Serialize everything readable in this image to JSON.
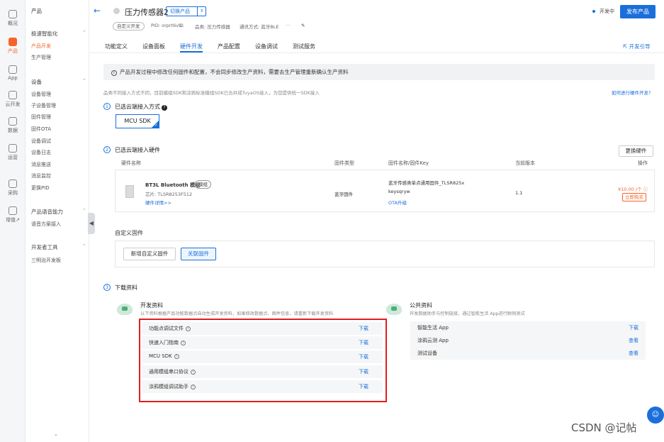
{
  "rail": [
    {
      "label": "概况",
      "icon": "home-icon",
      "active": false
    },
    {
      "label": "产品",
      "icon": "product-icon",
      "active": true
    },
    {
      "label": "App",
      "icon": "app-icon",
      "active": false
    },
    {
      "label": "云开发",
      "icon": "cloud-icon",
      "active": false
    },
    {
      "label": "数据",
      "icon": "chart-icon",
      "active": false
    },
    {
      "label": "运营",
      "icon": "operate-icon",
      "active": false
    },
    {
      "label": "采购",
      "icon": "cart-icon",
      "active": false
    },
    {
      "label": "增值↗",
      "icon": "diamond-icon",
      "active": false
    }
  ],
  "sidebar": {
    "title": "产品",
    "g1": "极速智能化",
    "g1_items": [
      "产品开发",
      "生产管理"
    ],
    "g2": "设备",
    "g2_items": [
      "设备管理",
      "子设备管理",
      "固件管理",
      "固件OTA",
      "设备调试",
      "设备日志",
      "消息推送",
      "消息监控",
      "更换PID"
    ],
    "g3": "产品语音能力",
    "g3_items": [
      "语音方案接入"
    ],
    "g4": "开发者工具",
    "g4_items": [
      "三明治开发板"
    ],
    "collapse": "◀",
    "bottom": "⌄"
  },
  "header": {
    "back": "←",
    "title": "压力传感器2",
    "switch": "切换产品",
    "switch_caret": "⇕",
    "tag": "自定义开发",
    "pid": "PID: orprt6vb",
    "category": "品类: 压力传感器",
    "comm": "通讯方式: 蓝牙BLE",
    "more": "···",
    "edit": "✎",
    "status": "开发中",
    "publish": "发布产品"
  },
  "tabs": [
    "功能定义",
    "设备面板",
    "硬件开发",
    "产品配置",
    "设备调试",
    "测试服务"
  ],
  "guide": "⇱ 开发引导",
  "notice": "产品开发过程中修改任何固件和配置，不会同步修改生产资料，需要去生产管理重新确认生产资料",
  "notice_icon": "i",
  "subtext": "品类不同接入方式不同，目前模组SDK和涂鸦标准模组SDK已合并成TuyaOS接入，为您提供统一SDK接入",
  "how_link": "如何进行硬件开发?",
  "step1": {
    "num": "1",
    "title": "已选云端接入方式",
    "q": "?",
    "choice": "MCU SDK",
    "check": "✓"
  },
  "step2": {
    "num": "2",
    "title": "已选云端接入硬件",
    "change_btn": "更换硬件",
    "headers": [
      "硬件名称",
      "固件类型",
      "固件名称/固件Key",
      "当前版本",
      "操作"
    ],
    "module": {
      "name": "BT3L Bluetooth 模组",
      "tag": "模组",
      "chip": "芯片: TLSR8253F512",
      "details": "硬件详情>>",
      "fw_type": "蓝牙固件",
      "fw_name": "蓝牙传感类单点通用固件_TLSR825x",
      "fw_key": "keysqryw",
      "ota": "OTA升级",
      "version": "1.1",
      "price": "¥10.00 /个 ⓘ",
      "buy": "立即购买"
    },
    "custom_title": "自定义固件",
    "new_fw": "新增自定义固件",
    "link_fw": "关联固件"
  },
  "step3": {
    "num": "3",
    "title": "下载资料",
    "dev": {
      "title": "开发资料",
      "desc": "以下资料根据产品功能数据点自动生成开发资料，如果修改数据点、固件信息，请重新下载开发资料",
      "rows": [
        {
          "label": "功能点调试文件",
          "action": "下载"
        },
        {
          "label": "快速入门指南",
          "action": "下载"
        },
        {
          "label": "MCU SDK",
          "action": "下载"
        },
        {
          "label": "通用模组串口协议",
          "action": "下载"
        },
        {
          "label": "涂鸦模组调试助手",
          "action": "下载"
        }
      ]
    },
    "public": {
      "title": "公共资料",
      "desc": "开发数据助手与控制链接，通过智能生活 App进行联网测试",
      "rows": [
        {
          "label": "智能生活 App",
          "action": "下载"
        },
        {
          "label": "涂鸦云测 App",
          "action": "查看"
        },
        {
          "label": "测试设备",
          "action": "查看"
        }
      ]
    }
  },
  "info_glyph": "i",
  "watermark": "CSDN @记帖",
  "fab": "☺",
  "colors": {
    "accent": "#1a6fdb",
    "brand": "#f5632a",
    "highlight": "#e21e1e"
  }
}
